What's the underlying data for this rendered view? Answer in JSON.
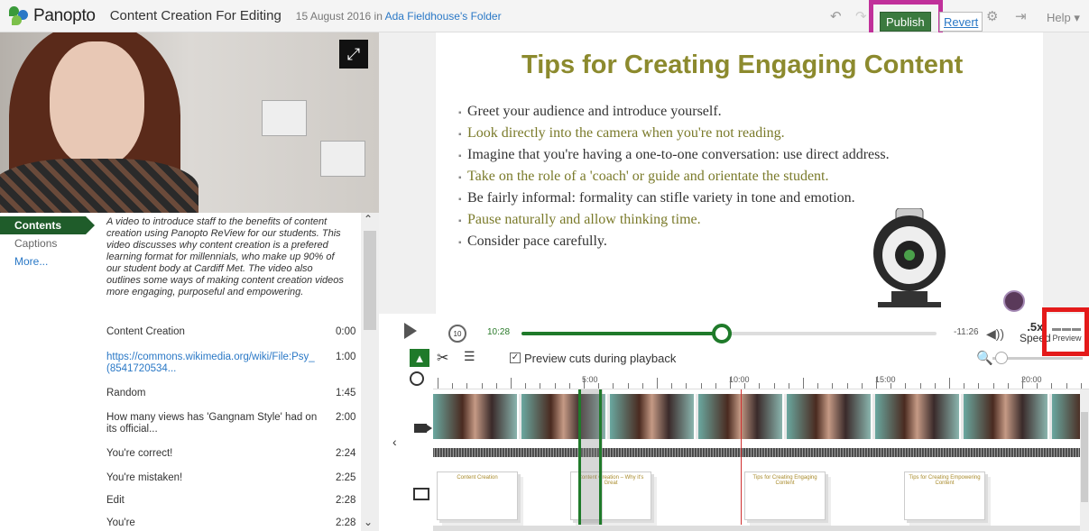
{
  "app": {
    "logo_text": "Panopto",
    "session_title": "Content Creation For Editing",
    "date_prefix": "15 August 2016 in",
    "folder_link": "Ada Fieldhouse's Folder",
    "colors": {
      "accent_green": "#1f7a2a",
      "publish_green": "#3b7a3f",
      "link_blue": "#2a78c6",
      "highlight_magenta": "#c0309a",
      "highlight_red": "#e41a1a"
    }
  },
  "toolbar": {
    "undo_icon": "undo-icon",
    "redo_icon": "redo-icon",
    "publish_label": "Publish",
    "revert_label": "Revert",
    "settings_icon": "gear-icon",
    "exit_icon": "exit-icon",
    "help_label": "Help ▾"
  },
  "left_tabs": {
    "contents": "Contents",
    "captions": "Captions",
    "more": "More..."
  },
  "description": "A video to introduce staff to the benefits of content creation using Panopto ReView for our students. This video discusses why content creation is a prefered learning format for millennials, who make up 90% of our student body at Cardiff Met. The video also outlines some ways of making content creation videos more engaging, purposeful and empowering.",
  "contents_list": [
    {
      "title": "Content Creation",
      "time": "0:00",
      "link": false
    },
    {
      "title": "https://commons.wikimedia.org/wiki/File:Psy_(8541720534...",
      "time": "1:00",
      "link": true
    },
    {
      "title": "Random",
      "time": "1:45",
      "link": false
    },
    {
      "title": "How many views has 'Gangnam Style' had on its official...",
      "time": "2:00",
      "link": false
    },
    {
      "title": "You're correct!",
      "time": "2:24",
      "link": false
    },
    {
      "title": "You're mistaken!",
      "time": "2:25",
      "link": false
    },
    {
      "title": "Edit",
      "time": "2:28",
      "link": false
    },
    {
      "title": "You're",
      "time": "2:28",
      "link": false
    }
  ],
  "slide": {
    "title": "Tips for Creating Engaging Content",
    "bullets": [
      {
        "text": "Greet your audience and introduce yourself.",
        "highlight": false
      },
      {
        "text": "Look directly into the camera when you're not reading.",
        "highlight": true
      },
      {
        "text": "Imagine that you're having a one-to-one conversation: use direct address.",
        "highlight": false
      },
      {
        "text": "Take on the role of a 'coach' or guide and orientate the student.",
        "highlight": true
      },
      {
        "text": "Be fairly informal: formality can stifle variety in tone and emotion.",
        "highlight": false
      },
      {
        "text": "Pause naturally and allow thinking time.",
        "highlight": true
      },
      {
        "text": "Consider pace carefully.",
        "highlight": false
      }
    ]
  },
  "player": {
    "rewind_label": "10",
    "current_time": "10:28",
    "remaining_time": "-11:26",
    "progress_fraction": 0.48,
    "speed_value": ".5x",
    "speed_label": "Speed",
    "preview_label": "Preview"
  },
  "editor": {
    "preview_cuts_label": "Preview cuts during playback",
    "preview_cuts_checked": true,
    "ruler_labels": [
      "5:00",
      "10:00",
      "15:00",
      "20:00"
    ]
  },
  "slide_thumbs": [
    {
      "title": "Content Creation"
    },
    {
      "title": "Content Creation – Why it's Great"
    },
    {
      "title": "Tips for Creating Engaging Content"
    },
    {
      "title": "Tips for Creating Empowering Content"
    }
  ]
}
